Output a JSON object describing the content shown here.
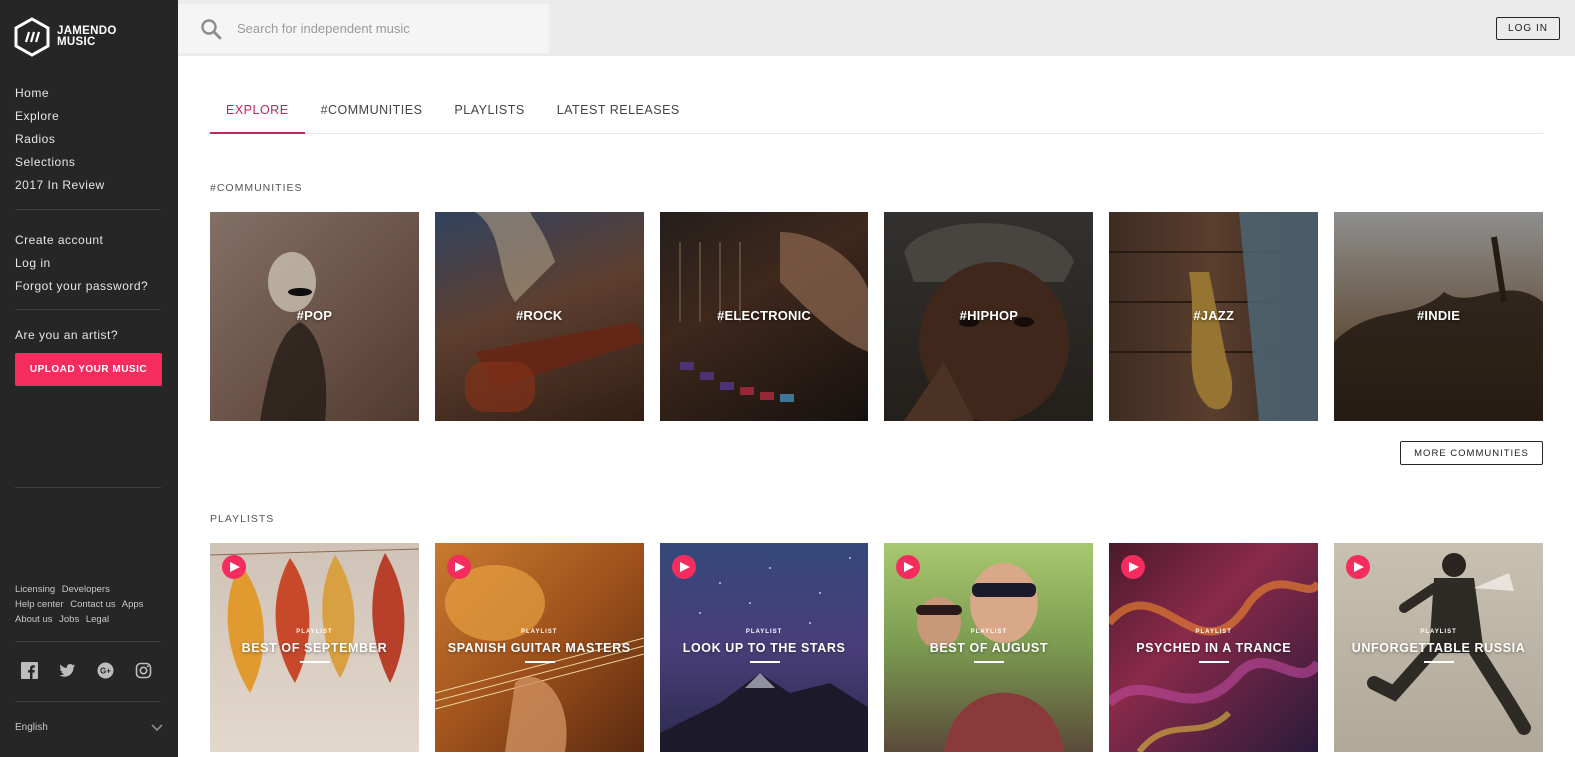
{
  "brand": {
    "line1": "JAMENDO",
    "line2": "MUSIC",
    "accent": "#f52d5e"
  },
  "sidebar": {
    "nav": [
      "Home",
      "Explore",
      "Radios",
      "Selections",
      "2017 In Review"
    ],
    "account": [
      "Create account",
      "Log in",
      "Forgot your password?"
    ],
    "artist_question": "Are you an artist?",
    "upload_label": "UPLOAD YOUR MUSIC",
    "footer_links": [
      "Licensing",
      "Developers",
      "Help center",
      "Contact us",
      "Apps",
      "About us",
      "Jobs",
      "Legal"
    ],
    "social_icons": [
      "facebook-icon",
      "twitter-icon",
      "google-plus-icon",
      "instagram-icon"
    ],
    "language": "English"
  },
  "search": {
    "placeholder": "Search for independent music"
  },
  "header": {
    "login_label": "LOG IN"
  },
  "tabs": [
    "EXPLORE",
    "#COMMUNITIES",
    "PLAYLISTS",
    "LATEST RELEASES"
  ],
  "communities": {
    "title": "#COMMUNITIES",
    "items": [
      "#POP",
      "#ROCK",
      "#ELECTRONIC",
      "#HIPHOP",
      "#JAZZ",
      "#INDIE"
    ],
    "more_label": "MORE COMMUNITIES"
  },
  "playlists": {
    "title": "PLAYLISTS",
    "kicker": "PLAYLIST",
    "items": [
      "BEST OF SEPTEMBER",
      "SPANISH GUITAR MASTERS",
      "LOOK UP TO THE STARS",
      "BEST OF AUGUST",
      "PSYCHED IN A TRANCE",
      "UNFORGETTABLE RUSSIA"
    ]
  }
}
